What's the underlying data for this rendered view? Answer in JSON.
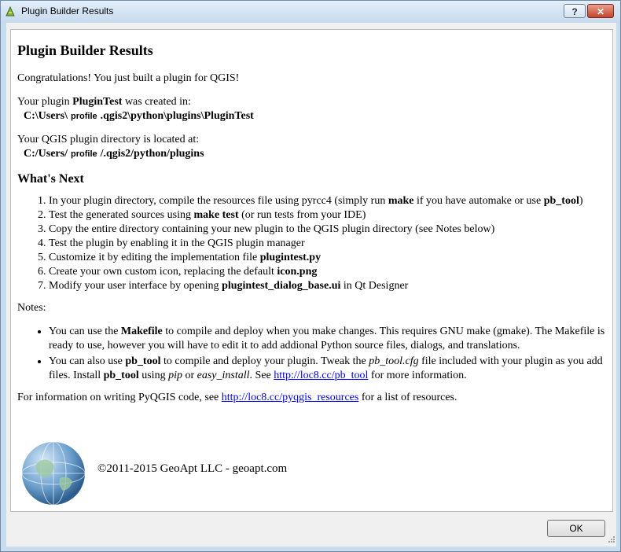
{
  "window": {
    "title": "Plugin Builder Results",
    "help_label": "?",
    "close_label": "✕"
  },
  "content": {
    "heading": "Plugin Builder Results",
    "congrats": "Congratulations! You just built a plugin for QGIS!",
    "created_prefix": "Your plugin ",
    "plugin_name": "PluginTest",
    "created_suffix": " was created in:",
    "created_path_start": "C:\\Users\\",
    "redacted_label": "profile",
    "created_path_end": ".qgis2\\python\\plugins\\PluginTest",
    "dir_text": "Your QGIS plugin directory is located at:",
    "dir_path_start": "C:/Users/",
    "dir_path_end": "/.qgis2/python/plugins",
    "whats_next": "What's Next",
    "steps": [
      {
        "pre": "In your plugin directory, compile the resources file using pyrcc4 (simply run ",
        "b1": "make",
        "mid": " if you have automake or use ",
        "b2": "pb_tool",
        "post": ")"
      },
      {
        "pre": "Test the generated sources using ",
        "b1": "make test",
        "mid": " (or run tests from your IDE)",
        "b2": "",
        "post": ""
      },
      {
        "pre": "Copy the entire directory containing your new plugin to the QGIS plugin directory (see Notes below)",
        "b1": "",
        "mid": "",
        "b2": "",
        "post": ""
      },
      {
        "pre": "Test the plugin by enabling it in the QGIS plugin manager",
        "b1": "",
        "mid": "",
        "b2": "",
        "post": ""
      },
      {
        "pre": "Customize it by editing the implementation file ",
        "b1": "plugintest.py",
        "mid": "",
        "b2": "",
        "post": ""
      },
      {
        "pre": "Create your own custom icon, replacing the default ",
        "b1": "icon.png",
        "mid": "",
        "b2": "",
        "post": ""
      },
      {
        "pre": "Modify your user interface by opening ",
        "b1": "plugintest_dialog_base.ui",
        "mid": " in Qt Designer",
        "b2": "",
        "post": ""
      }
    ],
    "notes_label": "Notes:",
    "note1": {
      "pre": "You can use the ",
      "b1": "Makefile",
      "post": " to compile and deploy when you make changes. This requires GNU make (gmake). The Makefile is ready to use, however you will have to edit it to add addional Python source files, dialogs, and translations."
    },
    "note2": {
      "a": "You can also use ",
      "b1": "pb_tool",
      "c": " to compile and deploy your plugin. Tweak the ",
      "i1": "pb_tool.cfg",
      "d": " file included with your plugin as you add files. Install ",
      "b2": "pb_tool",
      "e": " using ",
      "i2": "pip",
      "f": " or ",
      "i3": "easy_install",
      "g": ". See ",
      "link": "http://loc8.cc/pb_tool",
      "h": " for more information."
    },
    "info": {
      "pre": "For information on writing PyQGIS code, see ",
      "link": "http://loc8.cc/pyqgis_resources",
      "post": " for a list of resources."
    },
    "copyright": "©2011-2015 GeoApt LLC - geoapt.com"
  },
  "buttons": {
    "ok_label": "OK"
  },
  "colors": {
    "link": "#0000ee",
    "titlebar": "#c9dced",
    "close_button": "#c2432a"
  },
  "icons": {
    "app": "qgis-logo-icon",
    "logo": "globe-icon"
  }
}
